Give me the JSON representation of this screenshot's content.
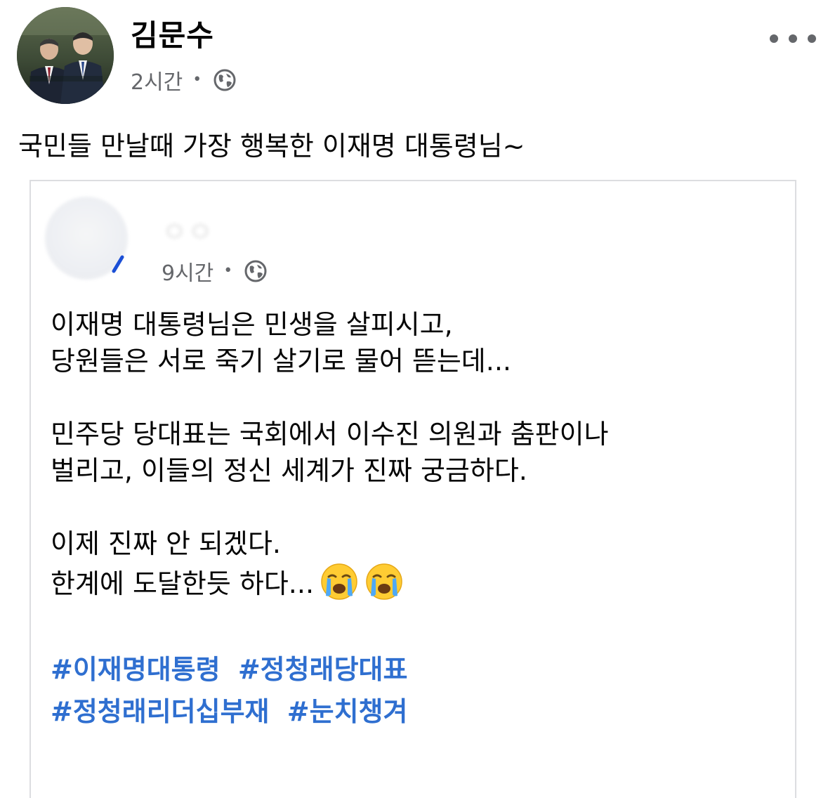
{
  "post": {
    "author_name": "김문수",
    "timestamp": "2시간",
    "separator": "•",
    "audience_icon": "globe-icon",
    "more_icon": "more-options-icon",
    "text": "국민들 만날때 가장 행복한 이재명 대통령님~"
  },
  "shared_post": {
    "timestamp": "9시간",
    "separator": "•",
    "audience_icon": "globe-icon",
    "lines": [
      "이재명 대통령님은 민생을 살피시고,",
      "당원들은 서로 죽기 살기로  물어 뜯는데...",
      "민주당 당대표는 국회에서 이수진 의원과 춤판이나",
      "벌리고, 이들의 정신 세계가 진짜 궁금하다.",
      "이제 진짜 안 되겠다.",
      "한계에 도달한듯 하다..."
    ],
    "emoji": [
      "crying-face-emoji",
      "crying-face-emoji"
    ],
    "hashtags": [
      "#이재명대통령",
      "#정청래당대표",
      "#정청래리더십부재",
      "#눈치챙겨"
    ]
  },
  "colors": {
    "text": "#050505",
    "secondary_text": "#65676b",
    "hashtag": "#2f6fd0",
    "card_border": "#dcdde0"
  }
}
